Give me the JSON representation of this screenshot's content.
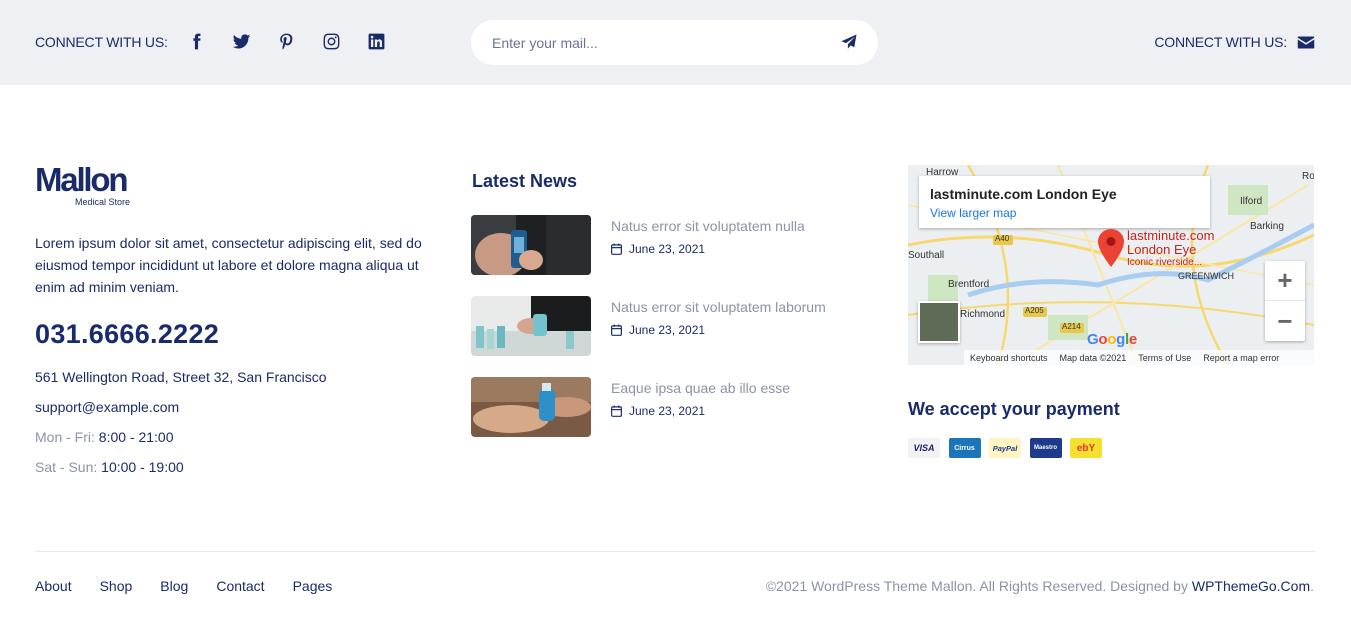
{
  "topbar": {
    "connect_left": "CONNECT WITH US:",
    "socials": [
      {
        "name": "facebook-icon"
      },
      {
        "name": "twitter-icon"
      },
      {
        "name": "pinterest-icon"
      },
      {
        "name": "instagram-icon"
      },
      {
        "name": "linkedin-icon"
      }
    ],
    "subscribe": {
      "placeholder": "Enter your mail...",
      "value": "",
      "icon": "send-icon"
    },
    "connect_right": "CONNECT WITH US:",
    "connect_right_icon": "envelope-icon"
  },
  "brand": {
    "name": "Mallon",
    "tagline": "Medical Store",
    "description": "Lorem ipsum dolor sit amet, consectetur adipiscing elit, sed do eiusmod tempor incididunt ut labore et dolore magna aliqua ut enim ad minim veniam.",
    "phone": "031.6666.2222",
    "address": "561 Wellington Road, Street 32, San Francisco",
    "email": "support@example.com",
    "hours": [
      {
        "label": "Mon - Fri:",
        "value": "8:00 - 21:00"
      },
      {
        "label": "Sat - Sun:",
        "value": "10:00 - 19:00"
      }
    ]
  },
  "news": {
    "title": "Latest News",
    "items": [
      {
        "title": "Natus error sit voluptatem nulla",
        "date": "June 23, 2021"
      },
      {
        "title": "Natus error sit voluptatem laborum",
        "date": "June 23, 2021"
      },
      {
        "title": "Eaque ipsa quae ab illo esse",
        "date": "June 23, 2021"
      }
    ]
  },
  "map": {
    "place": "lastminute.com London Eye",
    "larger_map": "View larger map",
    "pin_label_line1": "lastminute.com",
    "pin_label_line2": "London Eye",
    "pin_sub": "Iconic riverside...",
    "places": [
      "Harrow",
      "Ilford",
      "Barking",
      "Southall",
      "Brentford",
      "Richmond",
      "GREENWICH",
      "Ro"
    ],
    "roads": [
      "A40",
      "A205",
      "A214"
    ],
    "google": "Google",
    "footer": [
      "Keyboard shortcuts",
      "Map data ©2021",
      "Terms of Use",
      "Report a map error"
    ],
    "zoom_in": "+",
    "zoom_out": "−"
  },
  "payment": {
    "title": "We accept your payment",
    "cards": [
      {
        "name": "VISA",
        "bg": "#ffffff",
        "fg": "#1a1f71"
      },
      {
        "name": "Cirrus",
        "bg": "#1b75bb",
        "fg": "#ffffff"
      },
      {
        "name": "PayPal",
        "bg": "#fff4c2",
        "fg": "#1a3c8e"
      },
      {
        "name": "Maestro",
        "bg": "#1e3a8a",
        "fg": "#ffffff"
      },
      {
        "name": "ebY",
        "bg": "#f5e12d",
        "fg": "#e53238"
      }
    ]
  },
  "footer": {
    "nav": [
      "About",
      "Shop",
      "Blog",
      "Contact",
      "Pages"
    ],
    "copyright": "©2021 WordPress Theme Mallon. All Rights Reserved. Designed by ",
    "designer": "WPThemeGo.Com",
    "period": "."
  }
}
